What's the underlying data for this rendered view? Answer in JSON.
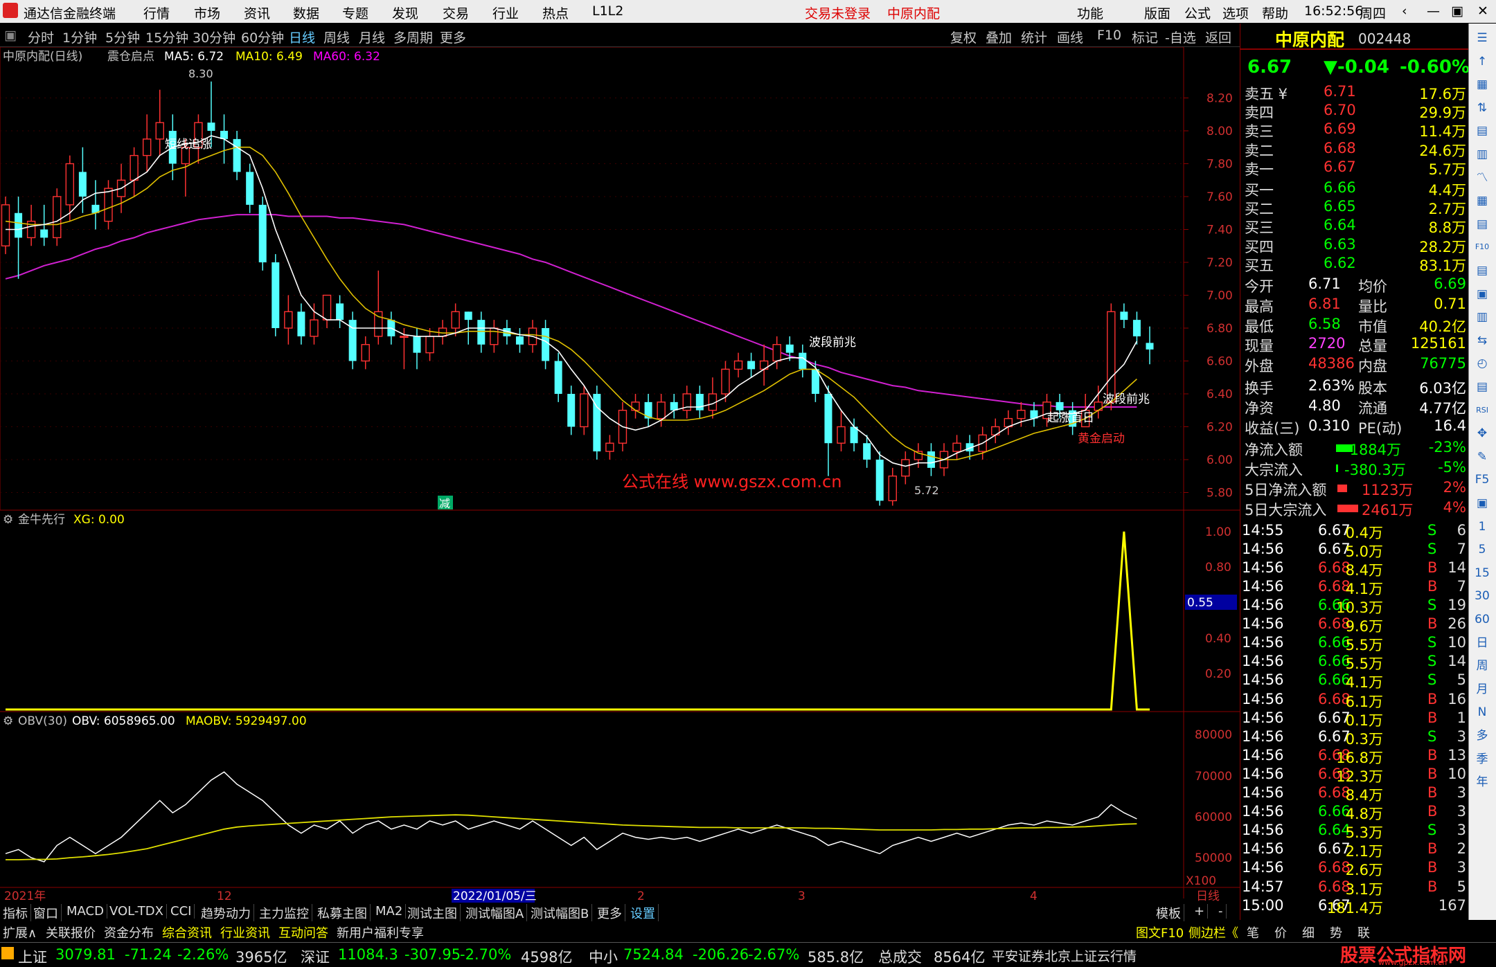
{
  "app": {
    "title": "通达信金融终端",
    "status": "交易未登录",
    "stock_title": "中原内配",
    "time": "16:52:56",
    "weekday": "周四"
  },
  "menu": [
    "行情",
    "市场",
    "资讯",
    "数据",
    "专题",
    "发现",
    "交易",
    "行业",
    "热点",
    "L1L2"
  ],
  "menu_right": [
    "功能",
    "版面",
    "公式",
    "选项",
    "帮助"
  ],
  "periods": [
    "分时",
    "1分钟",
    "5分钟",
    "15分钟",
    "30分钟",
    "60分钟",
    "日线",
    "周线",
    "月线",
    "多周期",
    "更多"
  ],
  "tools": [
    "复权",
    "叠加",
    "统计",
    "画线",
    "F10",
    "标记",
    "-自选",
    "返回"
  ],
  "main_legend": {
    "name": "中原内配(日线)",
    "indicator": "震仓启点",
    "ma5": "MA5: 6.72",
    "ma10": "MA10: 6.49",
    "ma60": "MA60: 6.32"
  },
  "price_axis": [
    "8.20",
    "8.00",
    "7.80",
    "7.60",
    "7.40",
    "7.20",
    "7.00",
    "6.80",
    "6.60",
    "6.40",
    "6.20",
    "6.00",
    "5.80"
  ],
  "annotations": {
    "high": "8.30",
    "low": "5.72",
    "a1": "短线追涨",
    "a2": "波段前兆",
    "a3": "起涨首日",
    "a4": "波段前兆",
    "a5": "黄金启动",
    "watermark": "公式在线 www.gszx.com.cn",
    "reduce": "减"
  },
  "sub1": {
    "name": "金牛先行",
    "xg": "XG: 0.00",
    "axis": [
      "1.00",
      "0.80",
      "0.55",
      "0.40",
      "0.20"
    ]
  },
  "sub2": {
    "name": "OBV(30)",
    "obv": "OBV: 6058965.00",
    "maobv": "MAOBV: 5929497.00",
    "axis": [
      "80000",
      "70000",
      "60000",
      "50000"
    ],
    "unit": "X100"
  },
  "date_axis": {
    "year": "2021年",
    "m12": "12",
    "cursor": "2022/01/05/三",
    "m1": "1",
    "m2": "2",
    "m3": "3",
    "m4": "4",
    "period": "日线"
  },
  "bottom_tabs": [
    "指标",
    "窗口",
    "MACD",
    "VOL-TDX",
    "CCI",
    "趋势动力",
    "主力监控",
    "私募主图",
    "MA2",
    "测试主图",
    "测试幅图A",
    "测试幅图B",
    "更多",
    "设置"
  ],
  "bottom_right": [
    "模板",
    "+",
    "-"
  ],
  "tabs2": [
    "扩展∧",
    "关联报价",
    "资金分布",
    "综合资讯",
    "行业资讯",
    "互动问答",
    "新用户福利专享"
  ],
  "tabs2_right": [
    "图文F10",
    "侧边栏《",
    "笔",
    "价",
    "细",
    "势",
    "联"
  ],
  "quote": {
    "name": "中原内配",
    "code": "002448",
    "price": "6.67",
    "change": "▼-0.04",
    "pct": "-0.60%",
    "asks": [
      [
        "卖五",
        "6.71",
        "17.6万"
      ],
      [
        "卖四",
        "6.70",
        "29.9万"
      ],
      [
        "卖三",
        "6.69",
        "11.4万"
      ],
      [
        "卖二",
        "6.68",
        "24.6万"
      ],
      [
        "卖一",
        "6.67",
        "5.7万"
      ]
    ],
    "bids": [
      [
        "买一",
        "6.66",
        "4.4万"
      ],
      [
        "买二",
        "6.65",
        "2.7万"
      ],
      [
        "买三",
        "6.64",
        "8.8万"
      ],
      [
        "买四",
        "6.63",
        "28.2万"
      ],
      [
        "买五",
        "6.62",
        "83.1万"
      ]
    ],
    "stats": [
      [
        "今开",
        "6.71",
        "均价",
        "6.69"
      ],
      [
        "最高",
        "6.81",
        "量比",
        "0.71"
      ],
      [
        "最低",
        "6.58",
        "市值",
        "40.2亿"
      ],
      [
        "现量",
        "2720",
        "总量",
        "125161"
      ],
      [
        "外盘",
        "48386",
        "内盘",
        "76775"
      ]
    ],
    "stats2": [
      [
        "换手",
        "2.63%",
        "股本",
        "6.03亿"
      ],
      [
        "净资",
        "4.80",
        "流通",
        "4.77亿"
      ],
      [
        "收益(三)",
        "0.310",
        "PE(动)",
        "16.4"
      ]
    ],
    "flows": [
      [
        "净流入额",
        "-1884万",
        "-23%"
      ],
      [
        "大宗流入",
        "-380.3万",
        "-5%"
      ],
      [
        "5日净流入额",
        "1123万",
        "2%"
      ],
      [
        "5日大宗流入",
        "2461万",
        "4%"
      ]
    ],
    "ticks": [
      [
        "14:55",
        "6.67",
        "0.4万",
        "S",
        "6"
      ],
      [
        "14:56",
        "6.67",
        "5.0万",
        "S",
        "7"
      ],
      [
        "14:56",
        "6.68",
        "8.4万",
        "B",
        "14"
      ],
      [
        "14:56",
        "6.68",
        "4.1万",
        "B",
        "7"
      ],
      [
        "14:56",
        "6.66",
        "10.3万",
        "S",
        "19"
      ],
      [
        "14:56",
        "6.68",
        "9.6万",
        "B",
        "26"
      ],
      [
        "14:56",
        "6.66",
        "5.5万",
        "S",
        "10"
      ],
      [
        "14:56",
        "6.66",
        "5.5万",
        "S",
        "14"
      ],
      [
        "14:56",
        "6.66",
        "4.1万",
        "S",
        "5"
      ],
      [
        "14:56",
        "6.68",
        "6.1万",
        "B",
        "16"
      ],
      [
        "14:56",
        "6.67",
        "0.1万",
        "B",
        "1"
      ],
      [
        "14:56",
        "6.67",
        "0.3万",
        "S",
        "3"
      ],
      [
        "14:56",
        "6.68",
        "16.8万",
        "B",
        "13"
      ],
      [
        "14:56",
        "6.68",
        "12.3万",
        "B",
        "10"
      ],
      [
        "14:56",
        "6.68",
        "8.4万",
        "B",
        "3"
      ],
      [
        "14:56",
        "6.66",
        "4.8万",
        "B",
        "3"
      ],
      [
        "14:56",
        "6.64",
        "5.3万",
        "S",
        "3"
      ],
      [
        "14:56",
        "6.67",
        "2.1万",
        "B",
        "2"
      ],
      [
        "14:56",
        "6.68",
        "2.6万",
        "B",
        "3"
      ],
      [
        "14:57",
        "6.68",
        "3.1万",
        "B",
        "5"
      ],
      [
        "15:00",
        "6.67",
        "181.4万",
        "",
        "167"
      ]
    ]
  },
  "sidebar": [
    "☰",
    "↑",
    "▦",
    "⇅",
    "▤",
    "▥",
    "〽",
    "▦",
    "▤",
    "F10",
    "▤",
    "▣",
    "▥",
    "⇆",
    "◴",
    "▤",
    "RSI",
    "✥",
    "✎",
    "F5",
    "▣",
    "1",
    "5",
    "15",
    "30",
    "60",
    "日",
    "周",
    "月",
    "N",
    "多",
    "季",
    "年"
  ],
  "statusbar": {
    "sh": "上证",
    "sh_v": "3079.81",
    "sh_c": "-71.24",
    "sh_p": "-2.26%",
    "sh_a": "3965亿",
    "sz": "深证",
    "sz_v": "11084.3",
    "sz_c": "-307.95",
    "sz_p": "-2.70%",
    "sz_a": "4598亿",
    "zx": "中小",
    "zx_v": "7524.84",
    "zx_c": "-206.26",
    "zx_p": "-2.67%",
    "zx_a": "585.8亿",
    "total": "总成交",
    "total_v": "8564亿",
    "server": "平安证券北京上证云行情",
    "logo": "股票公式指标网",
    "logo_url": "www.gpzx.com.cn"
  },
  "chart_data": {
    "type": "candlestick",
    "ylim": [
      5.7,
      8.3
    ],
    "candles": [
      [
        7.3,
        7.55,
        7.6,
        7.25
      ],
      [
        7.5,
        7.35,
        7.6,
        7.1
      ],
      [
        7.35,
        7.45,
        7.55,
        7.3
      ],
      [
        7.4,
        7.35,
        7.55,
        7.3
      ],
      [
        7.35,
        7.6,
        7.65,
        7.3
      ],
      [
        7.55,
        7.8,
        7.85,
        7.45
      ],
      [
        7.75,
        7.6,
        7.9,
        7.5
      ],
      [
        7.55,
        7.5,
        7.7,
        7.4
      ],
      [
        7.45,
        7.65,
        7.7,
        7.4
      ],
      [
        7.6,
        7.7,
        7.8,
        7.5
      ],
      [
        7.7,
        7.85,
        7.9,
        7.6
      ],
      [
        7.85,
        7.95,
        8.1,
        7.75
      ],
      [
        7.95,
        8.05,
        8.25,
        7.85
      ],
      [
        8.0,
        7.8,
        8.1,
        7.7
      ],
      [
        7.8,
        7.9,
        7.95,
        7.6
      ],
      [
        7.9,
        8.05,
        8.1,
        7.8
      ],
      [
        8.05,
        8.0,
        8.3,
        7.9
      ],
      [
        8.0,
        7.95,
        8.1,
        7.8
      ],
      [
        7.95,
        7.75,
        8.0,
        7.7
      ],
      [
        7.75,
        7.55,
        7.8,
        7.5
      ],
      [
        7.55,
        7.2,
        7.6,
        7.15
      ],
      [
        7.2,
        6.8,
        7.25,
        6.75
      ],
      [
        6.8,
        6.9,
        7.0,
        6.7
      ],
      [
        6.9,
        6.75,
        6.95,
        6.7
      ],
      [
        6.75,
        6.85,
        6.95,
        6.7
      ],
      [
        6.85,
        7.0,
        7.0,
        6.8
      ],
      [
        6.95,
        6.85,
        7.0,
        6.8
      ],
      [
        6.85,
        6.6,
        6.9,
        6.55
      ],
      [
        6.6,
        6.7,
        6.75,
        6.55
      ],
      [
        6.75,
        6.9,
        7.15,
        6.7
      ],
      [
        6.85,
        6.75,
        6.9,
        6.7
      ],
      [
        6.75,
        6.75,
        6.8,
        6.55
      ],
      [
        6.75,
        6.65,
        6.8,
        6.55
      ],
      [
        6.65,
        6.75,
        6.8,
        6.6
      ],
      [
        6.75,
        6.8,
        6.85,
        6.7
      ],
      [
        6.8,
        6.9,
        6.95,
        6.75
      ],
      [
        6.9,
        6.85,
        6.9,
        6.7
      ],
      [
        6.85,
        6.7,
        6.9,
        6.65
      ],
      [
        6.7,
        6.8,
        6.85,
        6.65
      ],
      [
        6.8,
        6.75,
        6.85,
        6.7
      ],
      [
        6.75,
        6.7,
        6.8,
        6.65
      ],
      [
        6.7,
        6.8,
        6.85,
        6.65
      ],
      [
        6.8,
        6.6,
        6.85,
        6.55
      ],
      [
        6.6,
        6.4,
        6.65,
        6.35
      ],
      [
        6.4,
        6.2,
        6.45,
        6.15
      ],
      [
        6.2,
        6.4,
        6.45,
        6.15
      ],
      [
        6.4,
        6.05,
        6.45,
        6.0
      ],
      [
        6.05,
        6.1,
        6.15,
        6.0
      ],
      [
        6.1,
        6.3,
        6.35,
        6.05
      ],
      [
        6.3,
        6.35,
        6.4,
        6.25
      ],
      [
        6.35,
        6.25,
        6.4,
        6.2
      ],
      [
        6.25,
        6.35,
        6.4,
        6.2
      ],
      [
        6.35,
        6.3,
        6.4,
        6.25
      ],
      [
        6.3,
        6.4,
        6.45,
        6.25
      ],
      [
        6.4,
        6.3,
        6.45,
        6.25
      ],
      [
        6.3,
        6.4,
        6.5,
        6.25
      ],
      [
        6.4,
        6.55,
        6.6,
        6.35
      ],
      [
        6.55,
        6.6,
        6.65,
        6.5
      ],
      [
        6.6,
        6.55,
        6.65,
        6.5
      ],
      [
        6.55,
        6.6,
        6.7,
        6.45
      ],
      [
        6.6,
        6.7,
        6.75,
        6.55
      ],
      [
        6.7,
        6.65,
        6.75,
        6.6
      ],
      [
        6.65,
        6.55,
        6.7,
        6.5
      ],
      [
        6.55,
        6.4,
        6.6,
        6.35
      ],
      [
        6.4,
        6.1,
        6.45,
        5.9
      ],
      [
        6.1,
        6.2,
        6.3,
        6.05
      ],
      [
        6.2,
        6.1,
        6.25,
        6.05
      ],
      [
        6.1,
        6.0,
        6.15,
        5.95
      ],
      [
        6.0,
        5.75,
        6.05,
        5.72
      ],
      [
        5.75,
        5.9,
        5.95,
        5.72
      ],
      [
        5.9,
        6.0,
        6.05,
        5.85
      ],
      [
        6.0,
        6.05,
        6.1,
        5.95
      ],
      [
        6.05,
        5.95,
        6.1,
        5.9
      ],
      [
        5.95,
        6.05,
        6.1,
        5.9
      ],
      [
        6.05,
        6.1,
        6.15,
        6.0
      ],
      [
        6.1,
        6.05,
        6.15,
        6.0
      ],
      [
        6.05,
        6.15,
        6.2,
        6.0
      ],
      [
        6.15,
        6.2,
        6.25,
        6.1
      ],
      [
        6.2,
        6.25,
        6.3,
        6.15
      ],
      [
        6.25,
        6.3,
        6.35,
        6.2
      ],
      [
        6.3,
        6.25,
        6.35,
        6.2
      ],
      [
        6.25,
        6.35,
        6.4,
        6.2
      ],
      [
        6.35,
        6.3,
        6.4,
        6.25
      ],
      [
        6.3,
        6.2,
        6.35,
        6.15
      ],
      [
        6.2,
        6.3,
        6.4,
        6.2
      ],
      [
        6.3,
        6.35,
        6.45,
        6.25
      ],
      [
        6.35,
        6.9,
        6.95,
        6.3
      ],
      [
        6.9,
        6.85,
        6.95,
        6.8
      ],
      [
        6.85,
        6.75,
        6.9,
        6.7
      ],
      [
        6.71,
        6.67,
        6.81,
        6.58
      ]
    ],
    "ma5": [
      7.4,
      7.4,
      7.42,
      7.43,
      7.45,
      7.5,
      7.58,
      7.62,
      7.63,
      7.65,
      7.7,
      7.75,
      7.85,
      7.9,
      7.92,
      7.93,
      7.97,
      7.95,
      7.9,
      7.85,
      7.65,
      7.4,
      7.2,
      7.0,
      6.9,
      6.85,
      6.85,
      6.8,
      6.8,
      6.8,
      6.8,
      6.76,
      6.75,
      6.75,
      6.75,
      6.77,
      6.8,
      6.8,
      6.8,
      6.78,
      6.76,
      6.75,
      6.72,
      6.66,
      6.55,
      6.45,
      6.32,
      6.25,
      6.2,
      6.18,
      6.2,
      6.24,
      6.3,
      6.32,
      6.32,
      6.34,
      6.38,
      6.45,
      6.5,
      6.55,
      6.6,
      6.62,
      6.62,
      6.56,
      6.42,
      6.3,
      6.2,
      6.14,
      6.03,
      5.98,
      5.96,
      5.98,
      5.98,
      6.0,
      6.04,
      6.07,
      6.1,
      6.15,
      6.2,
      6.23,
      6.25,
      6.28,
      6.28,
      6.28,
      6.3,
      6.4,
      6.5,
      6.58,
      6.72
    ],
    "ma10": [
      7.45,
      7.44,
      7.43,
      7.43,
      7.43,
      7.45,
      7.48,
      7.5,
      7.53,
      7.56,
      7.6,
      7.65,
      7.72,
      7.76,
      7.78,
      7.82,
      7.85,
      7.88,
      7.9,
      7.9,
      7.85,
      7.75,
      7.62,
      7.48,
      7.35,
      7.22,
      7.1,
      7.0,
      6.92,
      6.87,
      6.85,
      6.82,
      6.8,
      6.78,
      6.77,
      6.77,
      6.78,
      6.78,
      6.78,
      6.77,
      6.76,
      6.76,
      6.75,
      6.72,
      6.67,
      6.6,
      6.52,
      6.44,
      6.36,
      6.3,
      6.26,
      6.24,
      6.24,
      6.24,
      6.25,
      6.27,
      6.3,
      6.34,
      6.38,
      6.42,
      6.47,
      6.52,
      6.55,
      6.55,
      6.5,
      6.44,
      6.38,
      6.3,
      6.22,
      6.14,
      6.08,
      6.04,
      6.02,
      6.0,
      6.0,
      6.02,
      6.04,
      6.07,
      6.1,
      6.13,
      6.16,
      6.18,
      6.2,
      6.22,
      6.25,
      6.3,
      6.35,
      6.42,
      6.49
    ],
    "ma60": [
      7.1,
      7.12,
      7.15,
      7.18,
      7.2,
      7.22,
      7.25,
      7.28,
      7.3,
      7.33,
      7.35,
      7.38,
      7.4,
      7.42,
      7.44,
      7.46,
      7.47,
      7.48,
      7.49,
      7.49,
      7.49,
      7.49,
      7.48,
      7.48,
      7.48,
      7.48,
      7.47,
      7.47,
      7.46,
      7.45,
      7.44,
      7.43,
      7.41,
      7.39,
      7.37,
      7.35,
      7.33,
      7.31,
      7.29,
      7.27,
      7.25,
      7.22,
      7.2,
      7.17,
      7.14,
      7.11,
      7.08,
      7.05,
      7.02,
      6.99,
      6.96,
      6.93,
      6.9,
      6.87,
      6.84,
      6.81,
      6.78,
      6.75,
      6.72,
      6.69,
      6.66,
      6.63,
      6.61,
      6.58,
      6.56,
      6.53,
      6.51,
      6.49,
      6.47,
      6.45,
      6.44,
      6.42,
      6.41,
      6.4,
      6.39,
      6.38,
      6.37,
      6.36,
      6.35,
      6.34,
      6.33,
      6.33,
      6.32,
      6.32,
      6.32,
      6.32,
      6.32,
      6.32,
      6.32
    ],
    "obv": [
      520,
      530,
      510,
      500,
      540,
      560,
      540,
      520,
      540,
      560,
      590,
      620,
      650,
      620,
      640,
      670,
      700,
      720,
      690,
      670,
      650,
      620,
      590,
      570,
      590,
      580,
      600,
      570,
      590,
      600,
      580,
      590,
      580,
      600,
      590,
      600,
      580,
      590,
      600,
      590,
      580,
      600,
      580,
      560,
      540,
      560,
      530,
      550,
      570,
      560,
      555,
      560,
      555,
      560,
      550,
      560,
      570,
      580,
      570,
      580,
      590,
      580,
      570,
      560,
      540,
      550,
      540,
      530,
      520,
      540,
      550,
      560,
      550,
      560,
      570,
      560,
      570,
      580,
      590,
      595,
      590,
      600,
      595,
      590,
      600,
      610,
      640,
      620,
      605
    ],
    "maobv": [
      505,
      505,
      506,
      506,
      507,
      510,
      512,
      515,
      518,
      522,
      527,
      532,
      540,
      548,
      556,
      564,
      572,
      580,
      585,
      588,
      590,
      592,
      594,
      596,
      598,
      600,
      602,
      604,
      606,
      608,
      610,
      611,
      612,
      613,
      614,
      615,
      614,
      612,
      610,
      608,
      606,
      604,
      602,
      600,
      598,
      596,
      594,
      592,
      590,
      589,
      588,
      587,
      586,
      585,
      584,
      584,
      584,
      583,
      583,
      583,
      583,
      583,
      583,
      582,
      582,
      581,
      580,
      579,
      578,
      578,
      578,
      578,
      578,
      579,
      579,
      580,
      580,
      581,
      582,
      583,
      583,
      584,
      584,
      585,
      586,
      588,
      590,
      592,
      593
    ],
    "xg_spike_index": 87,
    "xg_level": "0.55"
  }
}
